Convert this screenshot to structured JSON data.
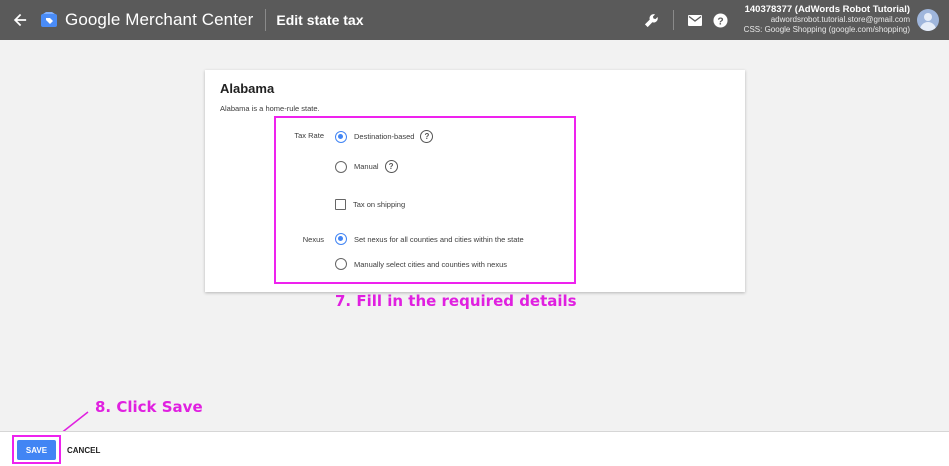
{
  "header": {
    "app_name": "Google Merchant Center",
    "page_title": "Edit state tax",
    "account_line1": "140378377 (AdWords Robot Tutorial)",
    "account_line2": "adwordsrobot.tutorial.store@gmail.com",
    "account_line3": "CSS: Google Shopping (google.com/shopping)",
    "icons": [
      "back-arrow-icon",
      "merchant-center-logo-icon",
      "wrench-icon",
      "mail-icon",
      "help-icon",
      "avatar-icon"
    ]
  },
  "card": {
    "state_name": "Alabama",
    "description": "Alabama is a home-rule state.",
    "tax_rate_label": "Tax Rate",
    "tax_rate_options": [
      {
        "label": "Destination-based",
        "selected": true
      },
      {
        "label": "Manual",
        "selected": false
      }
    ],
    "tax_on_shipping_label": "Tax on shipping",
    "tax_on_shipping_checked": false,
    "nexus_label": "Nexus",
    "nexus_options": [
      {
        "label": "Set nexus for all counties and cities within the state",
        "selected": true
      },
      {
        "label": "Manually select cities and counties with nexus",
        "selected": false
      }
    ]
  },
  "annotations": {
    "step7": "7. Fill in the required details",
    "step8": "8. Click Save"
  },
  "footer": {
    "save_label": "SAVE",
    "cancel_label": "CANCEL"
  },
  "colors": {
    "topbar": "#5a5a5a",
    "accent": "#4285f4",
    "annotation": "#e020e0"
  }
}
